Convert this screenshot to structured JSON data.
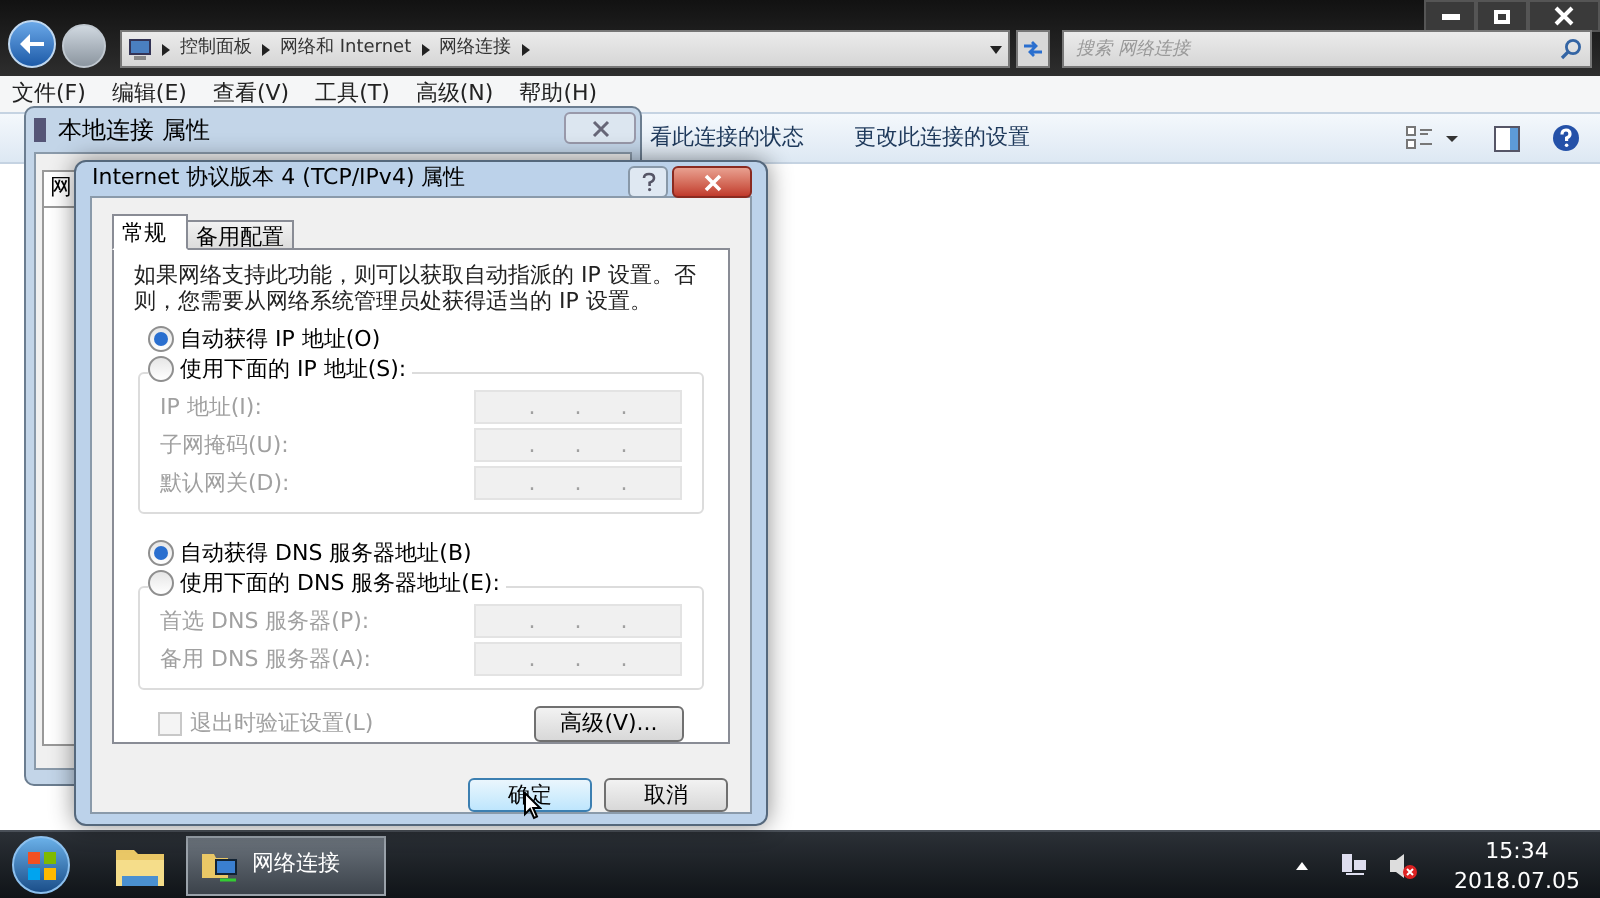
{
  "explorer": {
    "address": [
      "控制面板",
      "网络和 Internet",
      "网络连接"
    ],
    "search": {
      "placeholder": "搜索 网络连接"
    },
    "menu": [
      "文件(F)",
      "编辑(E)",
      "查看(V)",
      "工具(T)",
      "高级(N)",
      "帮助(H)"
    ],
    "toolbar": [
      "看此连接的状态",
      "更改此连接的设置"
    ]
  },
  "back_dialog": {
    "title": "本地连接 属性",
    "tab": "网"
  },
  "dialog": {
    "title": "Internet 协议版本 4 (TCP/IPv4) 属性",
    "tabs": [
      {
        "label": "常规",
        "selected": true
      },
      {
        "label": "备用配置",
        "selected": false
      }
    ],
    "description": "如果网络支持此功能，则可以获取自动指派的 IP 设置。否则，您需要从网络系统管理员处获得适当的 IP 设置。",
    "ip_options": [
      {
        "label": "自动获得 IP 地址(O)",
        "selected": true
      },
      {
        "label": "使用下面的 IP 地址(S):",
        "selected": false
      }
    ],
    "ip_group": {
      "disabled": true,
      "fields": [
        {
          "label": "IP 地址(I):",
          "value": ". . ."
        },
        {
          "label": "子网掩码(U):",
          "value": ". . ."
        },
        {
          "label": "默认网关(D):",
          "value": ". . ."
        }
      ]
    },
    "dns_options": [
      {
        "label": "自动获得 DNS 服务器地址(B)",
        "selected": true
      },
      {
        "label": "使用下面的 DNS 服务器地址(E):",
        "selected": false
      }
    ],
    "dns_group": {
      "disabled": true,
      "fields": [
        {
          "label": "首选 DNS 服务器(P):",
          "value": ". . ."
        },
        {
          "label": "备用 DNS 服务器(A):",
          "value": ". . ."
        }
      ]
    },
    "validate": {
      "label": "退出时验证设置(L)",
      "checked": false,
      "disabled": true
    },
    "advanced_button": "高级(V)...",
    "buttons": [
      {
        "label": "确定",
        "default": true
      },
      {
        "label": "取消",
        "default": false
      }
    ]
  },
  "taskbar": {
    "tasks": [
      {
        "label": "网络连接",
        "active": true
      }
    ],
    "time": "15:34",
    "date": "2018.07.05"
  }
}
